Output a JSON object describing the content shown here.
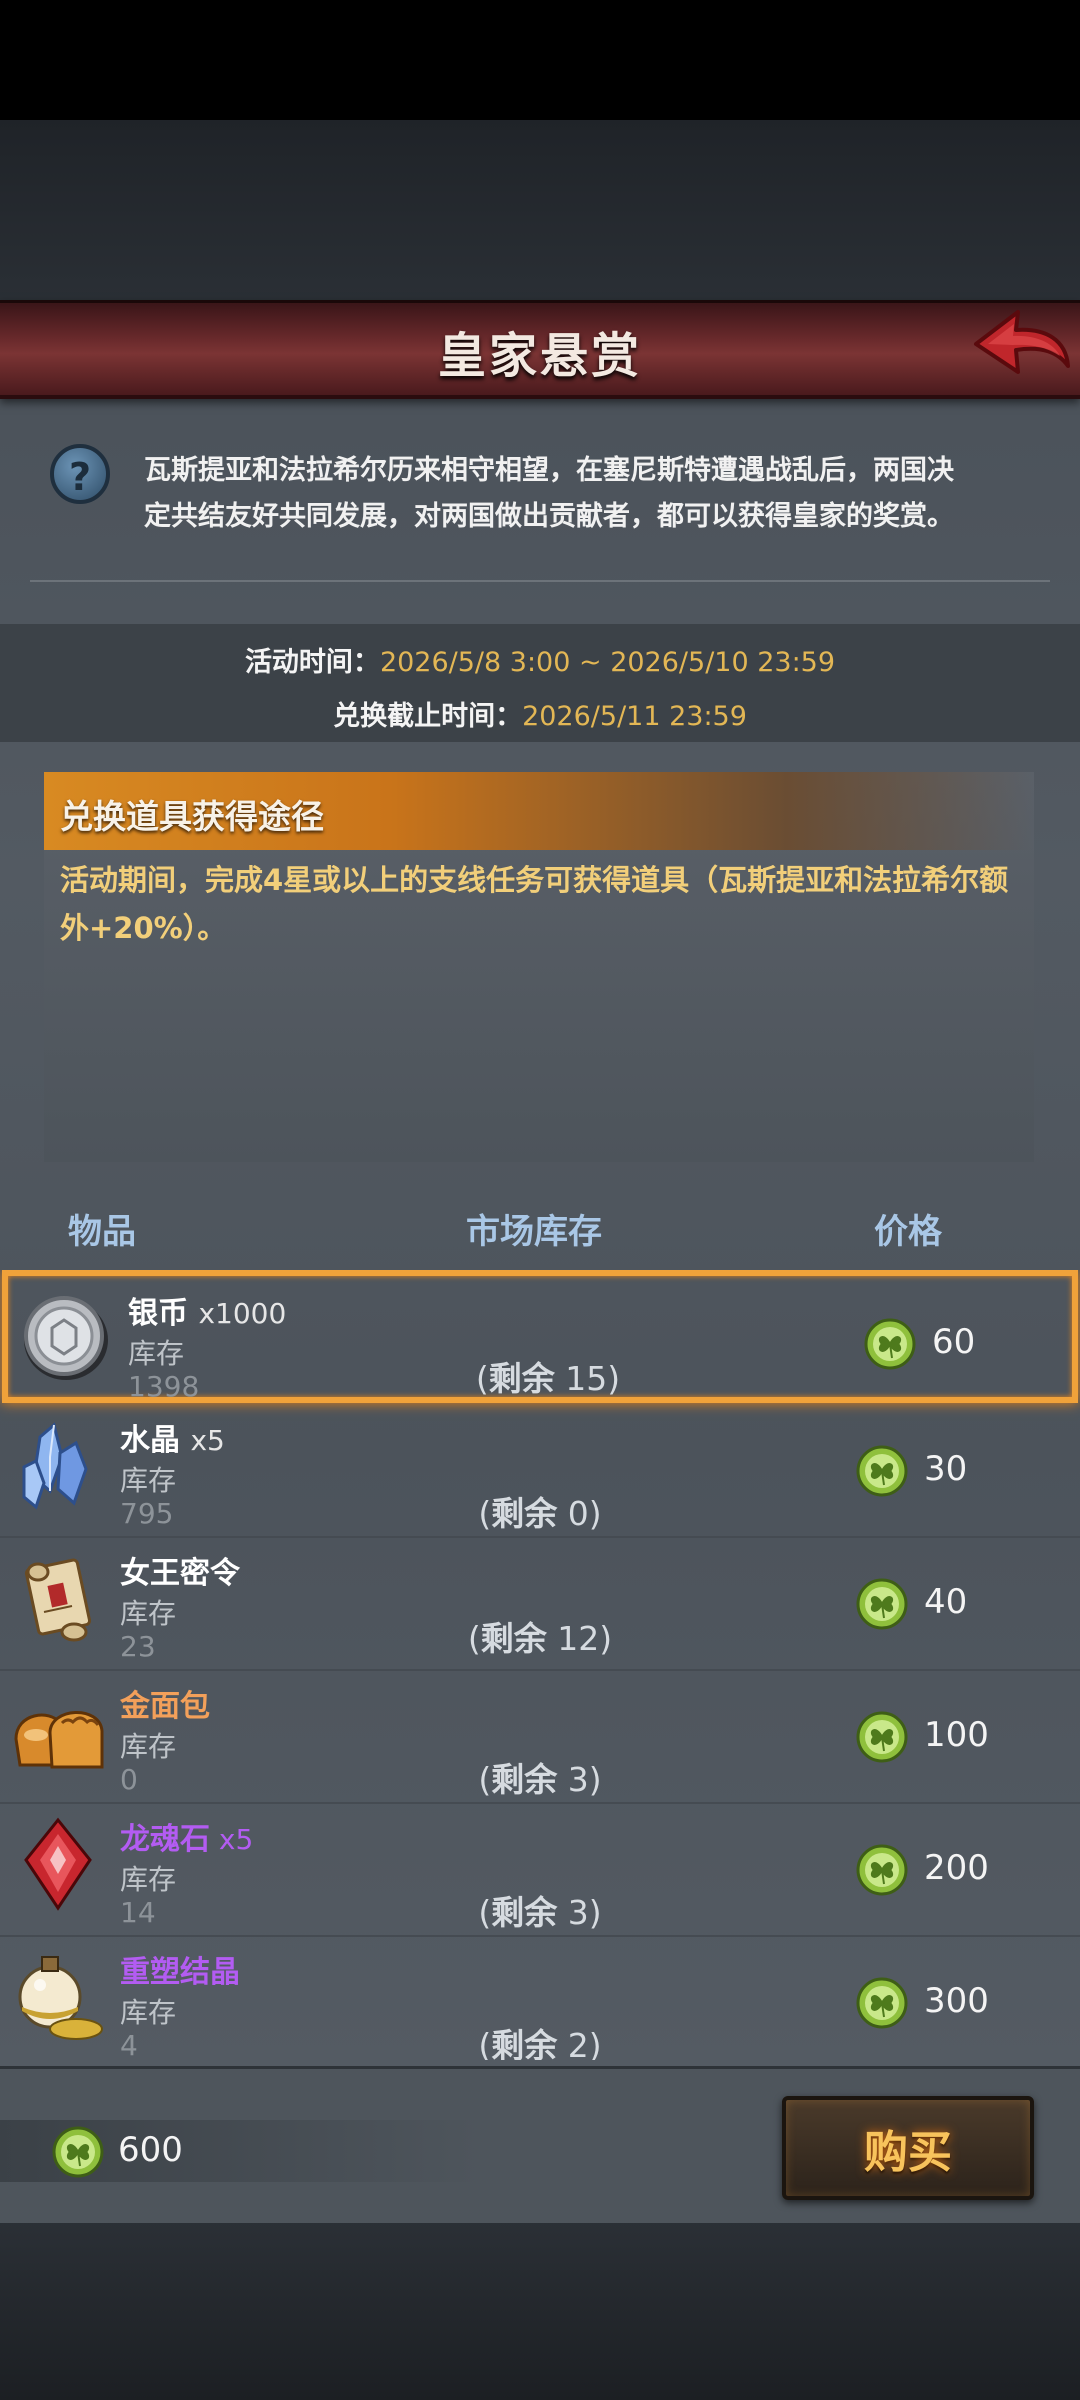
{
  "header": {
    "title": "皇家悬赏"
  },
  "intro": {
    "text": "瓦斯提亚和法拉希尔历来相守相望，在塞尼斯特遭遇战乱后，两国决定共结友好共同发展，对两国做出贡献者，都可以获得皇家的奖赏。"
  },
  "help": {
    "glyph": "?"
  },
  "event": {
    "time_label": "活动时间：",
    "time_value": "2026/5/8 3:00 ~ 2026/5/10 23:59",
    "deadline_label": "兑换截止时间：",
    "deadline_value": "2026/5/11 23:59"
  },
  "acquire": {
    "title": "兑换道具获得途径",
    "text": "活动期间，完成4星或以上的支线任务可获得道具（瓦斯提亚和法拉希尔额外+20%）。"
  },
  "columns": {
    "item": "物品",
    "stock": "市场库存",
    "price": "价格"
  },
  "items": [
    {
      "name": "银币",
      "qty": "x1000",
      "stock_label": "库存",
      "stock": "1398",
      "remain_prefix": "(",
      "remain_label": "剩余",
      "remain_value": " 15)",
      "price": "60"
    },
    {
      "name": "水晶",
      "qty": "x5",
      "stock_label": "库存",
      "stock": "795",
      "remain_prefix": "(",
      "remain_label": "剩余",
      "remain_value": " 0)",
      "price": "30"
    },
    {
      "name": "女王密令",
      "qty": "",
      "stock_label": "库存",
      "stock": "23",
      "remain_prefix": "(",
      "remain_label": "剩余",
      "remain_value": " 12)",
      "price": "40"
    },
    {
      "name": "金面包",
      "qty": "",
      "stock_label": "库存",
      "stock": "0",
      "remain_prefix": "(",
      "remain_label": "剩余",
      "remain_value": " 3)",
      "price": "100"
    },
    {
      "name": "龙魂石",
      "qty": " x5",
      "stock_label": "库存",
      "stock": "14",
      "remain_prefix": "(",
      "remain_label": "剩余",
      "remain_value": " 3)",
      "price": "200"
    },
    {
      "name": "重塑结晶",
      "qty": "",
      "stock_label": "库存",
      "stock": "4",
      "remain_prefix": "(",
      "remain_label": "剩余",
      "remain_value": " 2)",
      "price": "300"
    }
  ],
  "footer": {
    "balance": "600",
    "buy_label": "购买"
  },
  "colors": {
    "accent_orange": "#f0a23a",
    "price_gold": "#e3b755",
    "rare_purple": "#b35cf2",
    "item_gold": "#f3a05a"
  }
}
